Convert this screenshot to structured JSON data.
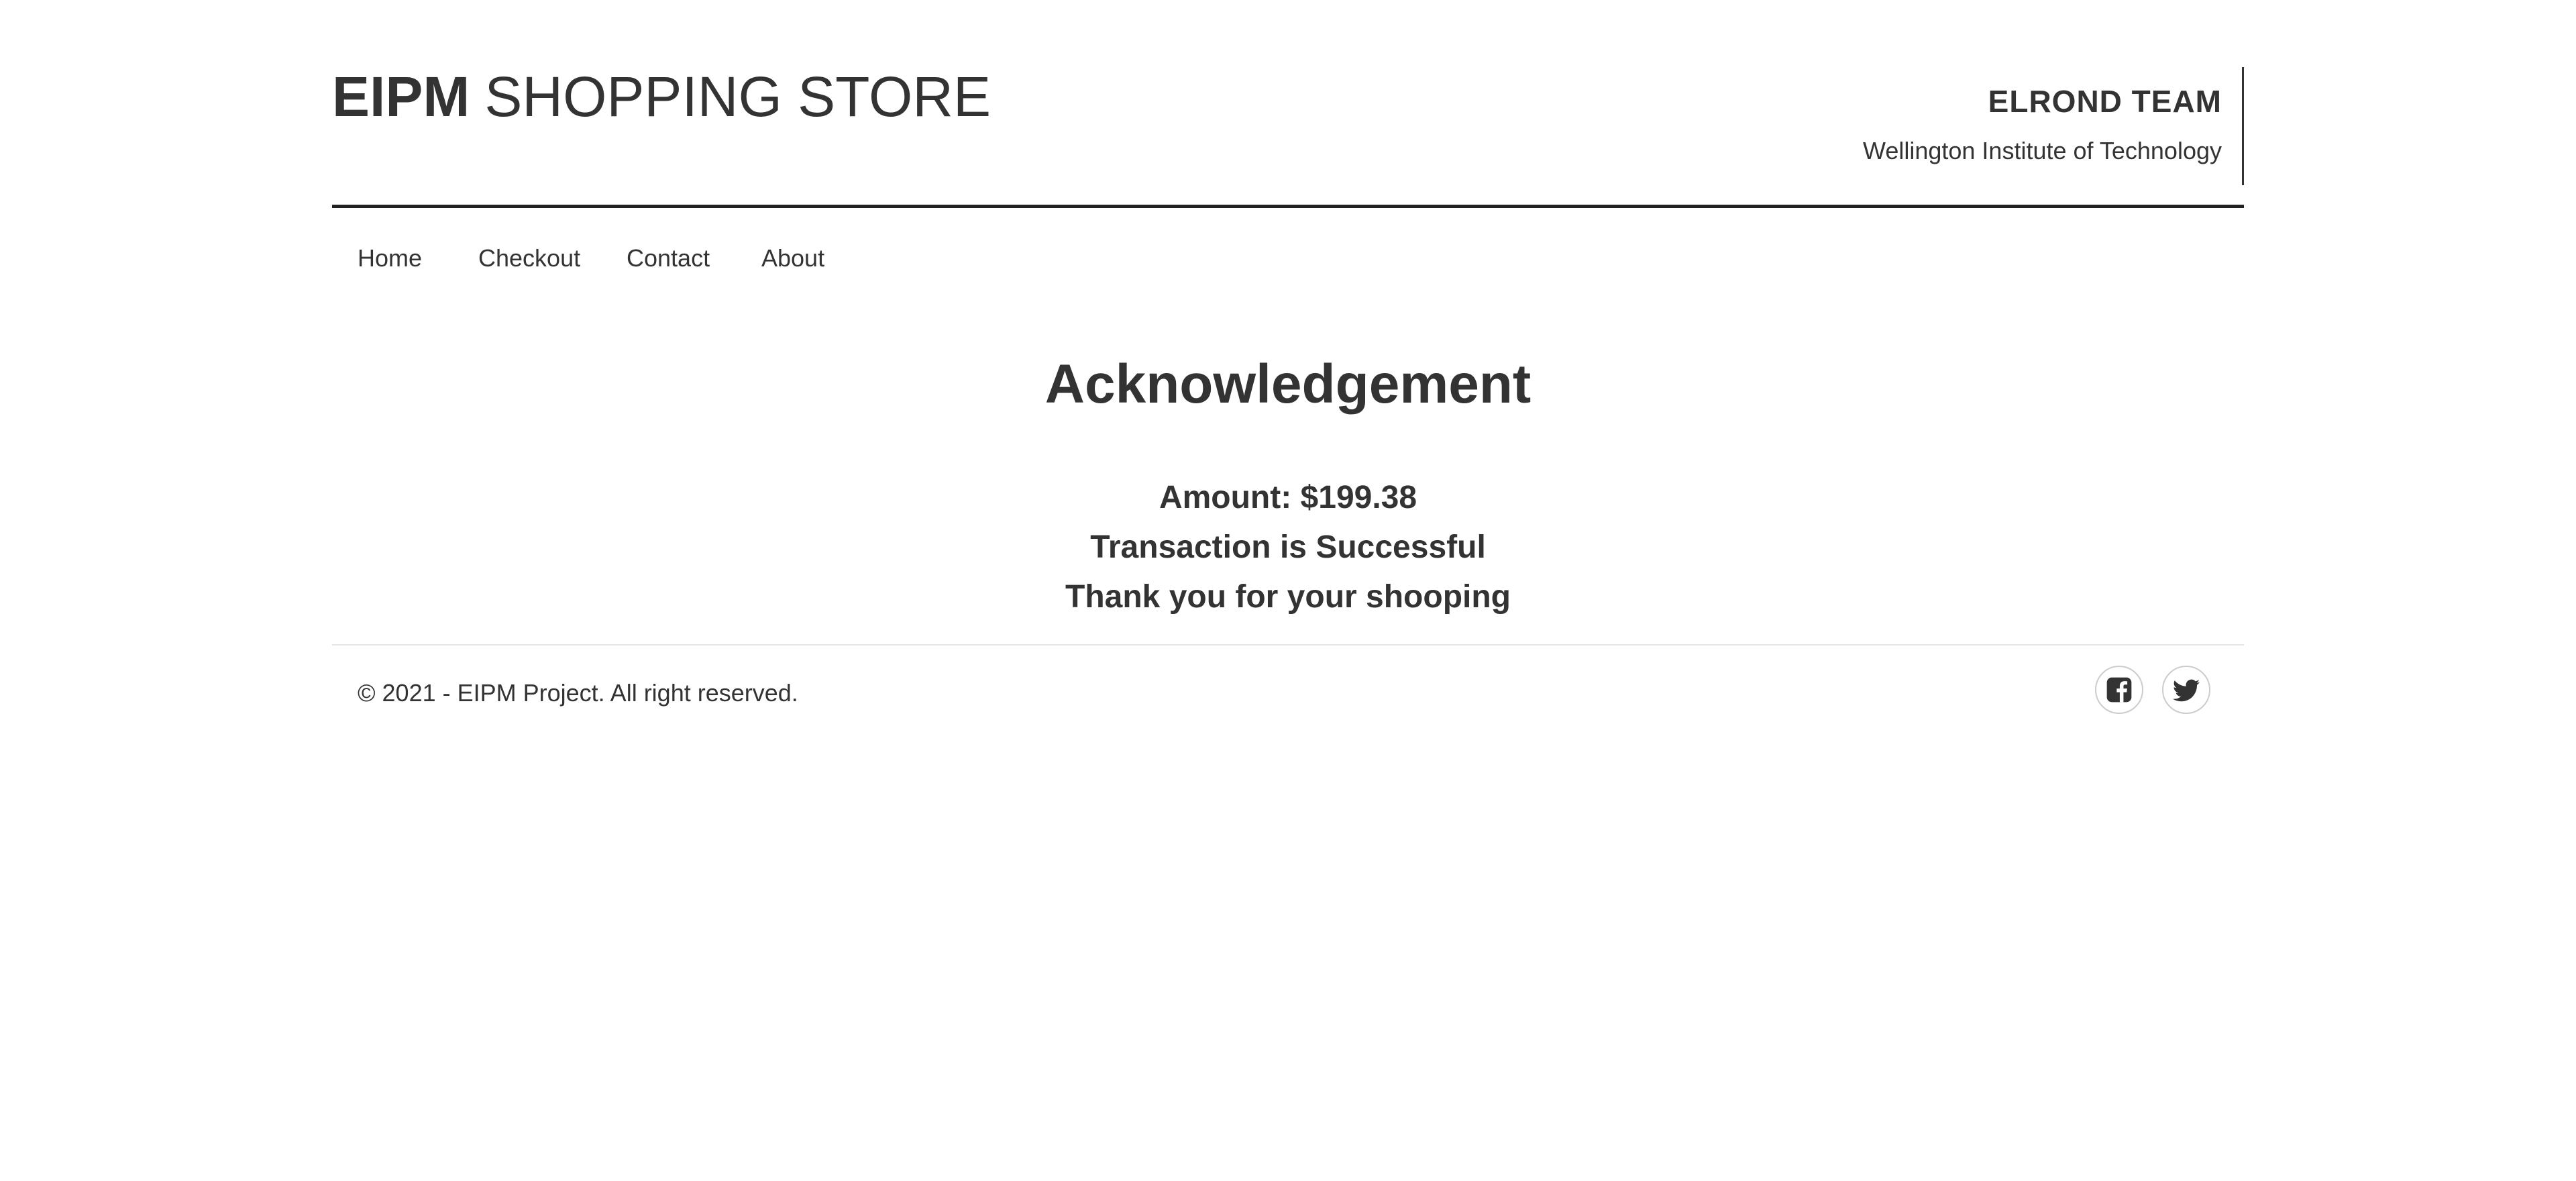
{
  "header": {
    "brand_bold": "EIPM",
    "brand_rest": "SHOPPING STORE",
    "team_name": "ELROND TEAM",
    "institution": "Wellington Institute of Technology"
  },
  "nav": {
    "items": [
      {
        "label": "Home"
      },
      {
        "label": "Checkout"
      },
      {
        "label": "Contact"
      },
      {
        "label": "About"
      }
    ]
  },
  "main": {
    "title": "Acknowledgement",
    "amount": "Amount: $199.38",
    "status": "Transaction is Successful",
    "thanks": "Thank you for your shooping"
  },
  "footer": {
    "copyright": "© 2021 - EIPM Project. All right reserved.",
    "social": [
      {
        "icon": "facebook-icon"
      },
      {
        "icon": "twitter-icon"
      }
    ]
  },
  "colors": {
    "text": "#333333",
    "header_rule": "#222222",
    "footer_rule": "#e5e5e5",
    "social_border": "#cccccc"
  }
}
